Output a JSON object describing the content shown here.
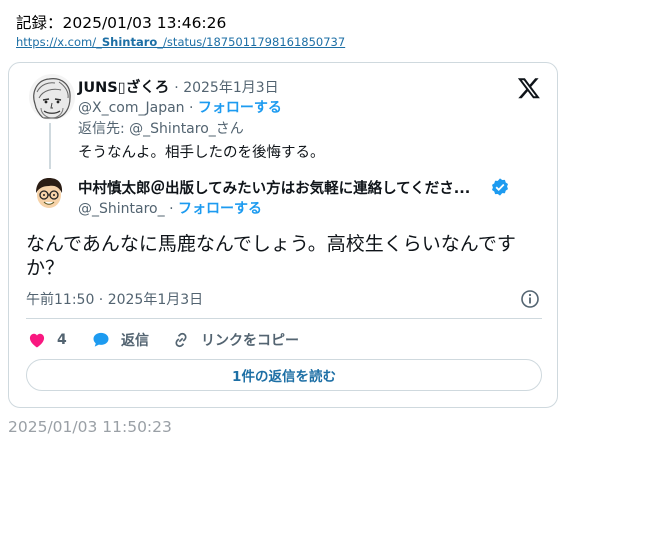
{
  "record": {
    "label": "記録：2025/01/03 13:46:26",
    "link_prefix": "https://x.com/",
    "link_user": "_Shintaro_",
    "link_suffix": "/status/1875011798161850737"
  },
  "parent_tweet": {
    "display_name": "JUNS▯ざくろ",
    "date": "· 2025年1月3日",
    "handle": "@X_com_Japan",
    "separator": "·",
    "follow_label": "フォローする",
    "reply_to": "返信先: @_Shintaro_さん",
    "text": "そうなんよ。相手したのを後悔する。"
  },
  "main_tweet": {
    "display_name": "中村慎太郎＠出版してみたい方はお気軽に連絡してくださ...",
    "handle": "@_Shintaro_",
    "separator": "·",
    "follow_label": "フォローする",
    "text": "なんであんなに馬鹿なんでしょう。高校生くらいなんですか？",
    "timestamp": "午前11:50 · 2025年1月3日"
  },
  "actions": {
    "like_count": "4",
    "reply_label": "返信",
    "copy_label": "リンクをコピー",
    "read_replies_label": "1件の返信を読む"
  },
  "footer": {
    "timestamp": "2025/01/03 11:50:23"
  },
  "icons": {
    "logo": "x-logo-icon",
    "verified": "verified-badge-icon",
    "info": "info-icon",
    "like": "heart-icon",
    "reply": "reply-bubble-icon",
    "copy": "link-icon"
  },
  "colors": {
    "accent": "#1d9bf0",
    "like": "#f91880",
    "text": "#0f1419",
    "muted": "#536471",
    "border": "#cfd9de"
  }
}
